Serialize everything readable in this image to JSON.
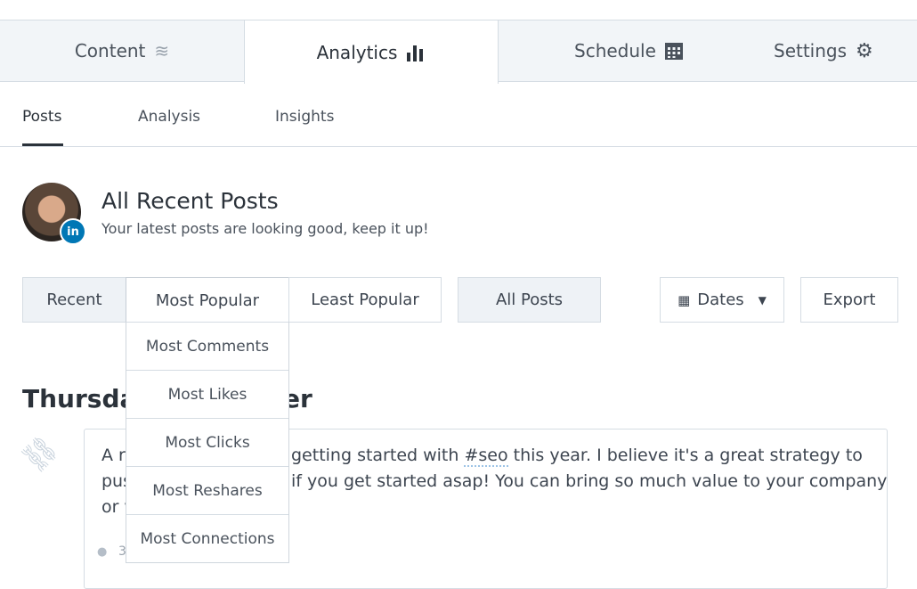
{
  "top_tabs": [
    {
      "label": "Content",
      "icon": "layers-icon"
    },
    {
      "label": "Analytics",
      "icon": "bar-chart-icon"
    },
    {
      "label": "Schedule",
      "icon": "calendar-icon"
    },
    {
      "label": "Settings",
      "icon": "gear-icon"
    }
  ],
  "sub_tabs": [
    "Posts",
    "Analysis",
    "Insights"
  ],
  "header": {
    "title": "All Recent Posts",
    "subtitle": "Your latest posts are looking good, keep it up!",
    "badge": "in"
  },
  "filters": {
    "recent": "Recent",
    "most_popular": "Most Popular",
    "least_popular": "Least Popular",
    "all_posts": "All Posts",
    "dates": "Dates",
    "export": "Export"
  },
  "dropdown": [
    "Most Comments",
    "Most Likes",
    "Most Clicks",
    "Most Reshares",
    "Most Connections"
  ],
  "section": {
    "heading_left": "Thursday",
    "heading_right": "er"
  },
  "post": {
    "l1a": "A r",
    "l1b": "getting started with ",
    "hashtag": "#seo",
    "l1c": " this year. I believe it's a great strategy to",
    "l2a": "pus",
    "l2b": "if you get started asap! You can bring so much value to your company",
    "l3a": "or v",
    "meta": "3"
  },
  "colors": {
    "linkedin": "#0077b5",
    "tab_bg": "#f2f5f8",
    "border": "#d5dce3"
  }
}
